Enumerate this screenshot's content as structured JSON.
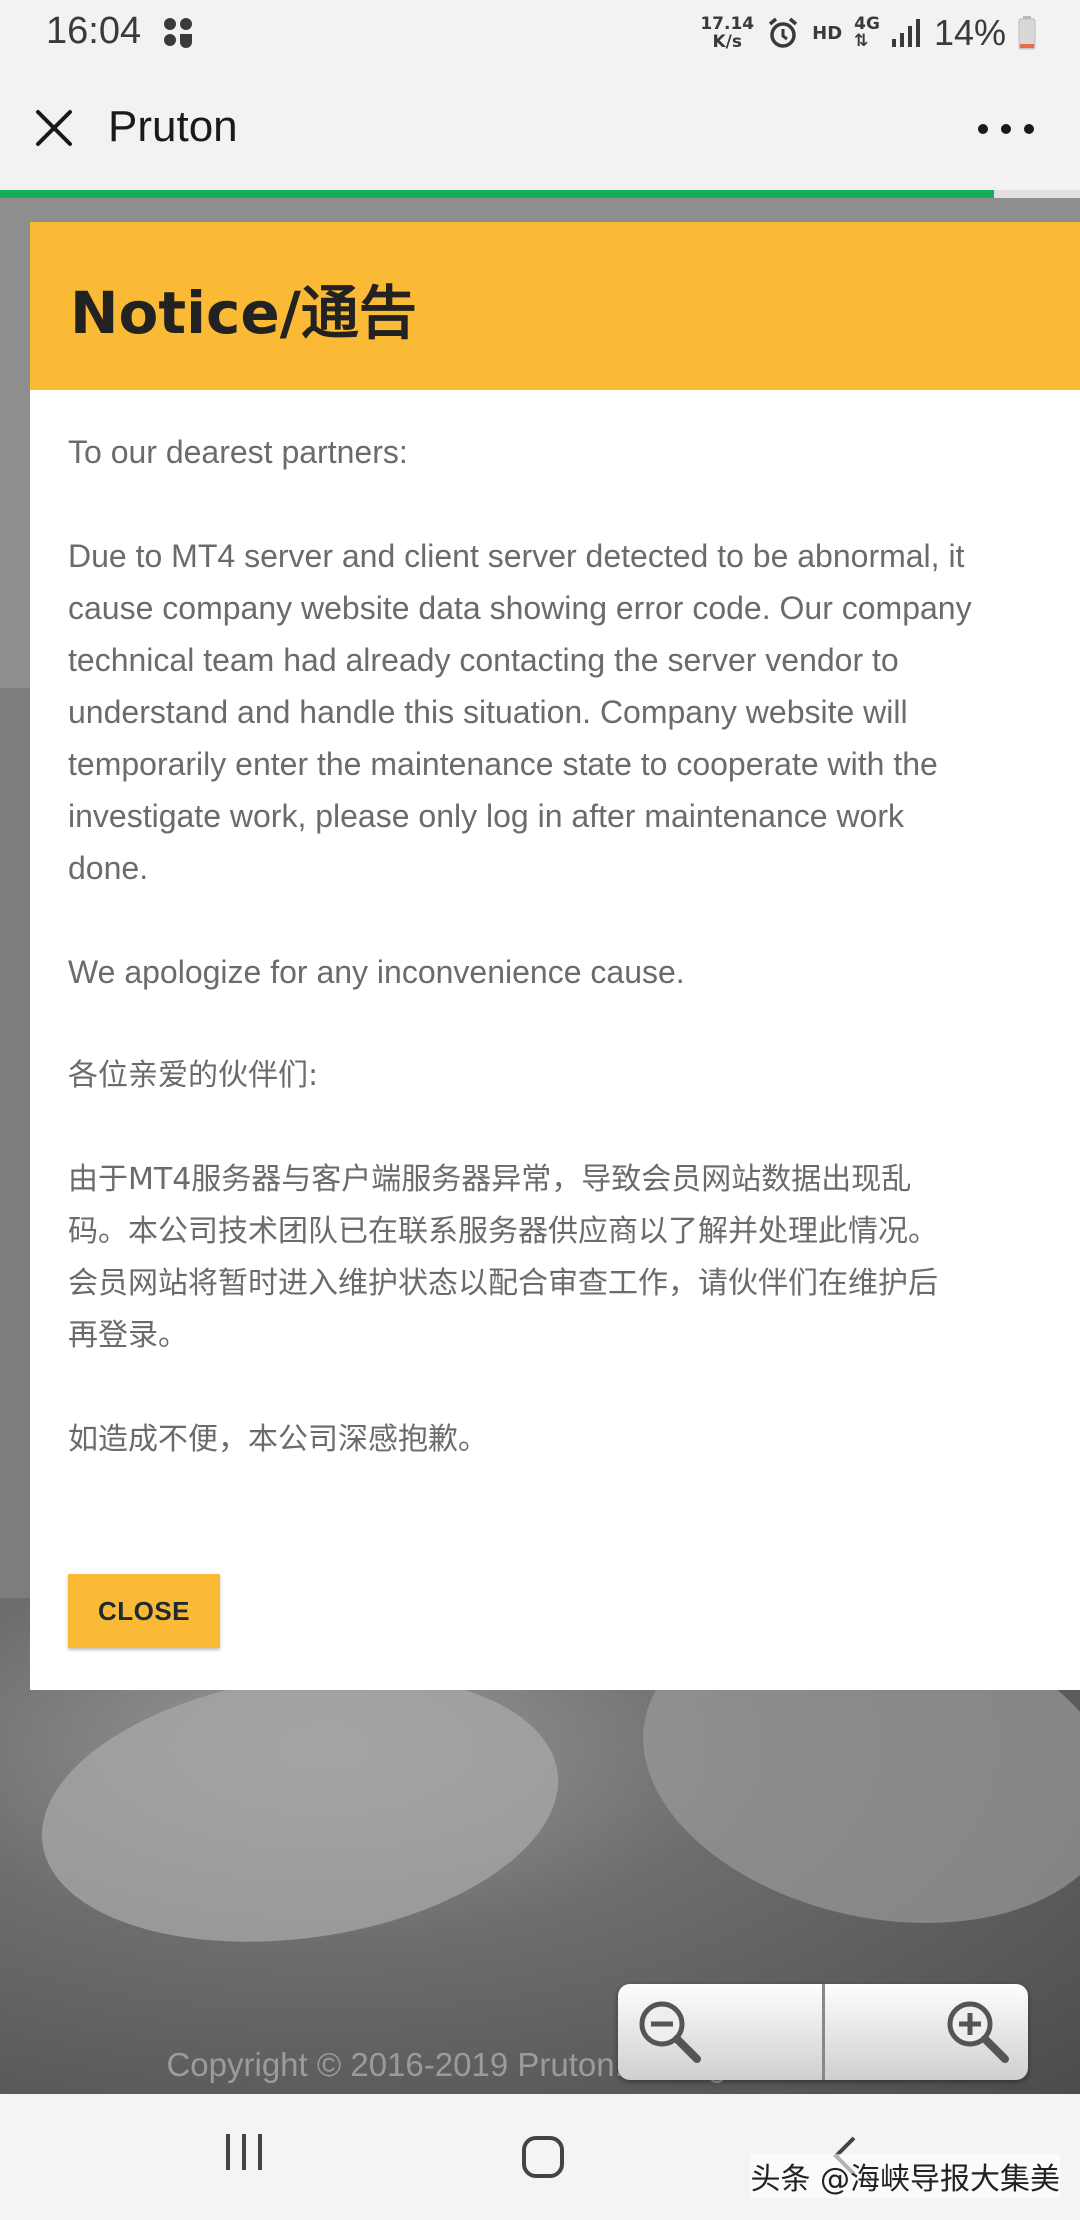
{
  "status_bar": {
    "time": "16:04",
    "net_speed_value": "17.14",
    "net_speed_unit": "K/s",
    "hd": "HD",
    "network": "4G",
    "battery": "14%",
    "icons": [
      "notification-icon",
      "alarm-icon",
      "signal-icon",
      "battery-icon"
    ]
  },
  "app_bar": {
    "title": "Pruton",
    "page_load_progress": 0.92,
    "accent": "#1aad58"
  },
  "dialog": {
    "title": "Notice/通告",
    "header_color": "#fbba36",
    "greeting_en": "To our dearest partners:",
    "body_en": [
      "Due to MT4 server and client server detected to be abnormal, it",
      "cause company website data showing error code. Our company",
      "technical team had already contacting the server vendor to",
      "understand and handle this situation. Company website will",
      "temporarily enter the maintenance state to cooperate with the",
      "investigate work, please only log in after maintenance work",
      "done."
    ],
    "apology_en": "We apologize for any inconvenience cause.",
    "greeting_zh": "各位亲爱的伙伴们:",
    "body_zh": [
      "由于MT4服务器与客户端服务器异常，导致会员网站数据出现乱",
      "码。本公司技术团队已在联系服务器供应商以了解并处理此情况。",
      "会员网站将暂时进入维护状态以配合审查工作，请伙伴们在维护后",
      "再登录。"
    ],
    "apology_zh": "如造成不便，本公司深感抱歉。",
    "close_label": "CLOSE"
  },
  "footer": {
    "copyright": "Copyright © 2016-2019 Pruton. All Right Reserved."
  },
  "zoom": {
    "out_icon": "zoom-out-icon",
    "in_icon": "zoom-in-icon"
  },
  "watermark": "头条 @海峡导报大集美"
}
